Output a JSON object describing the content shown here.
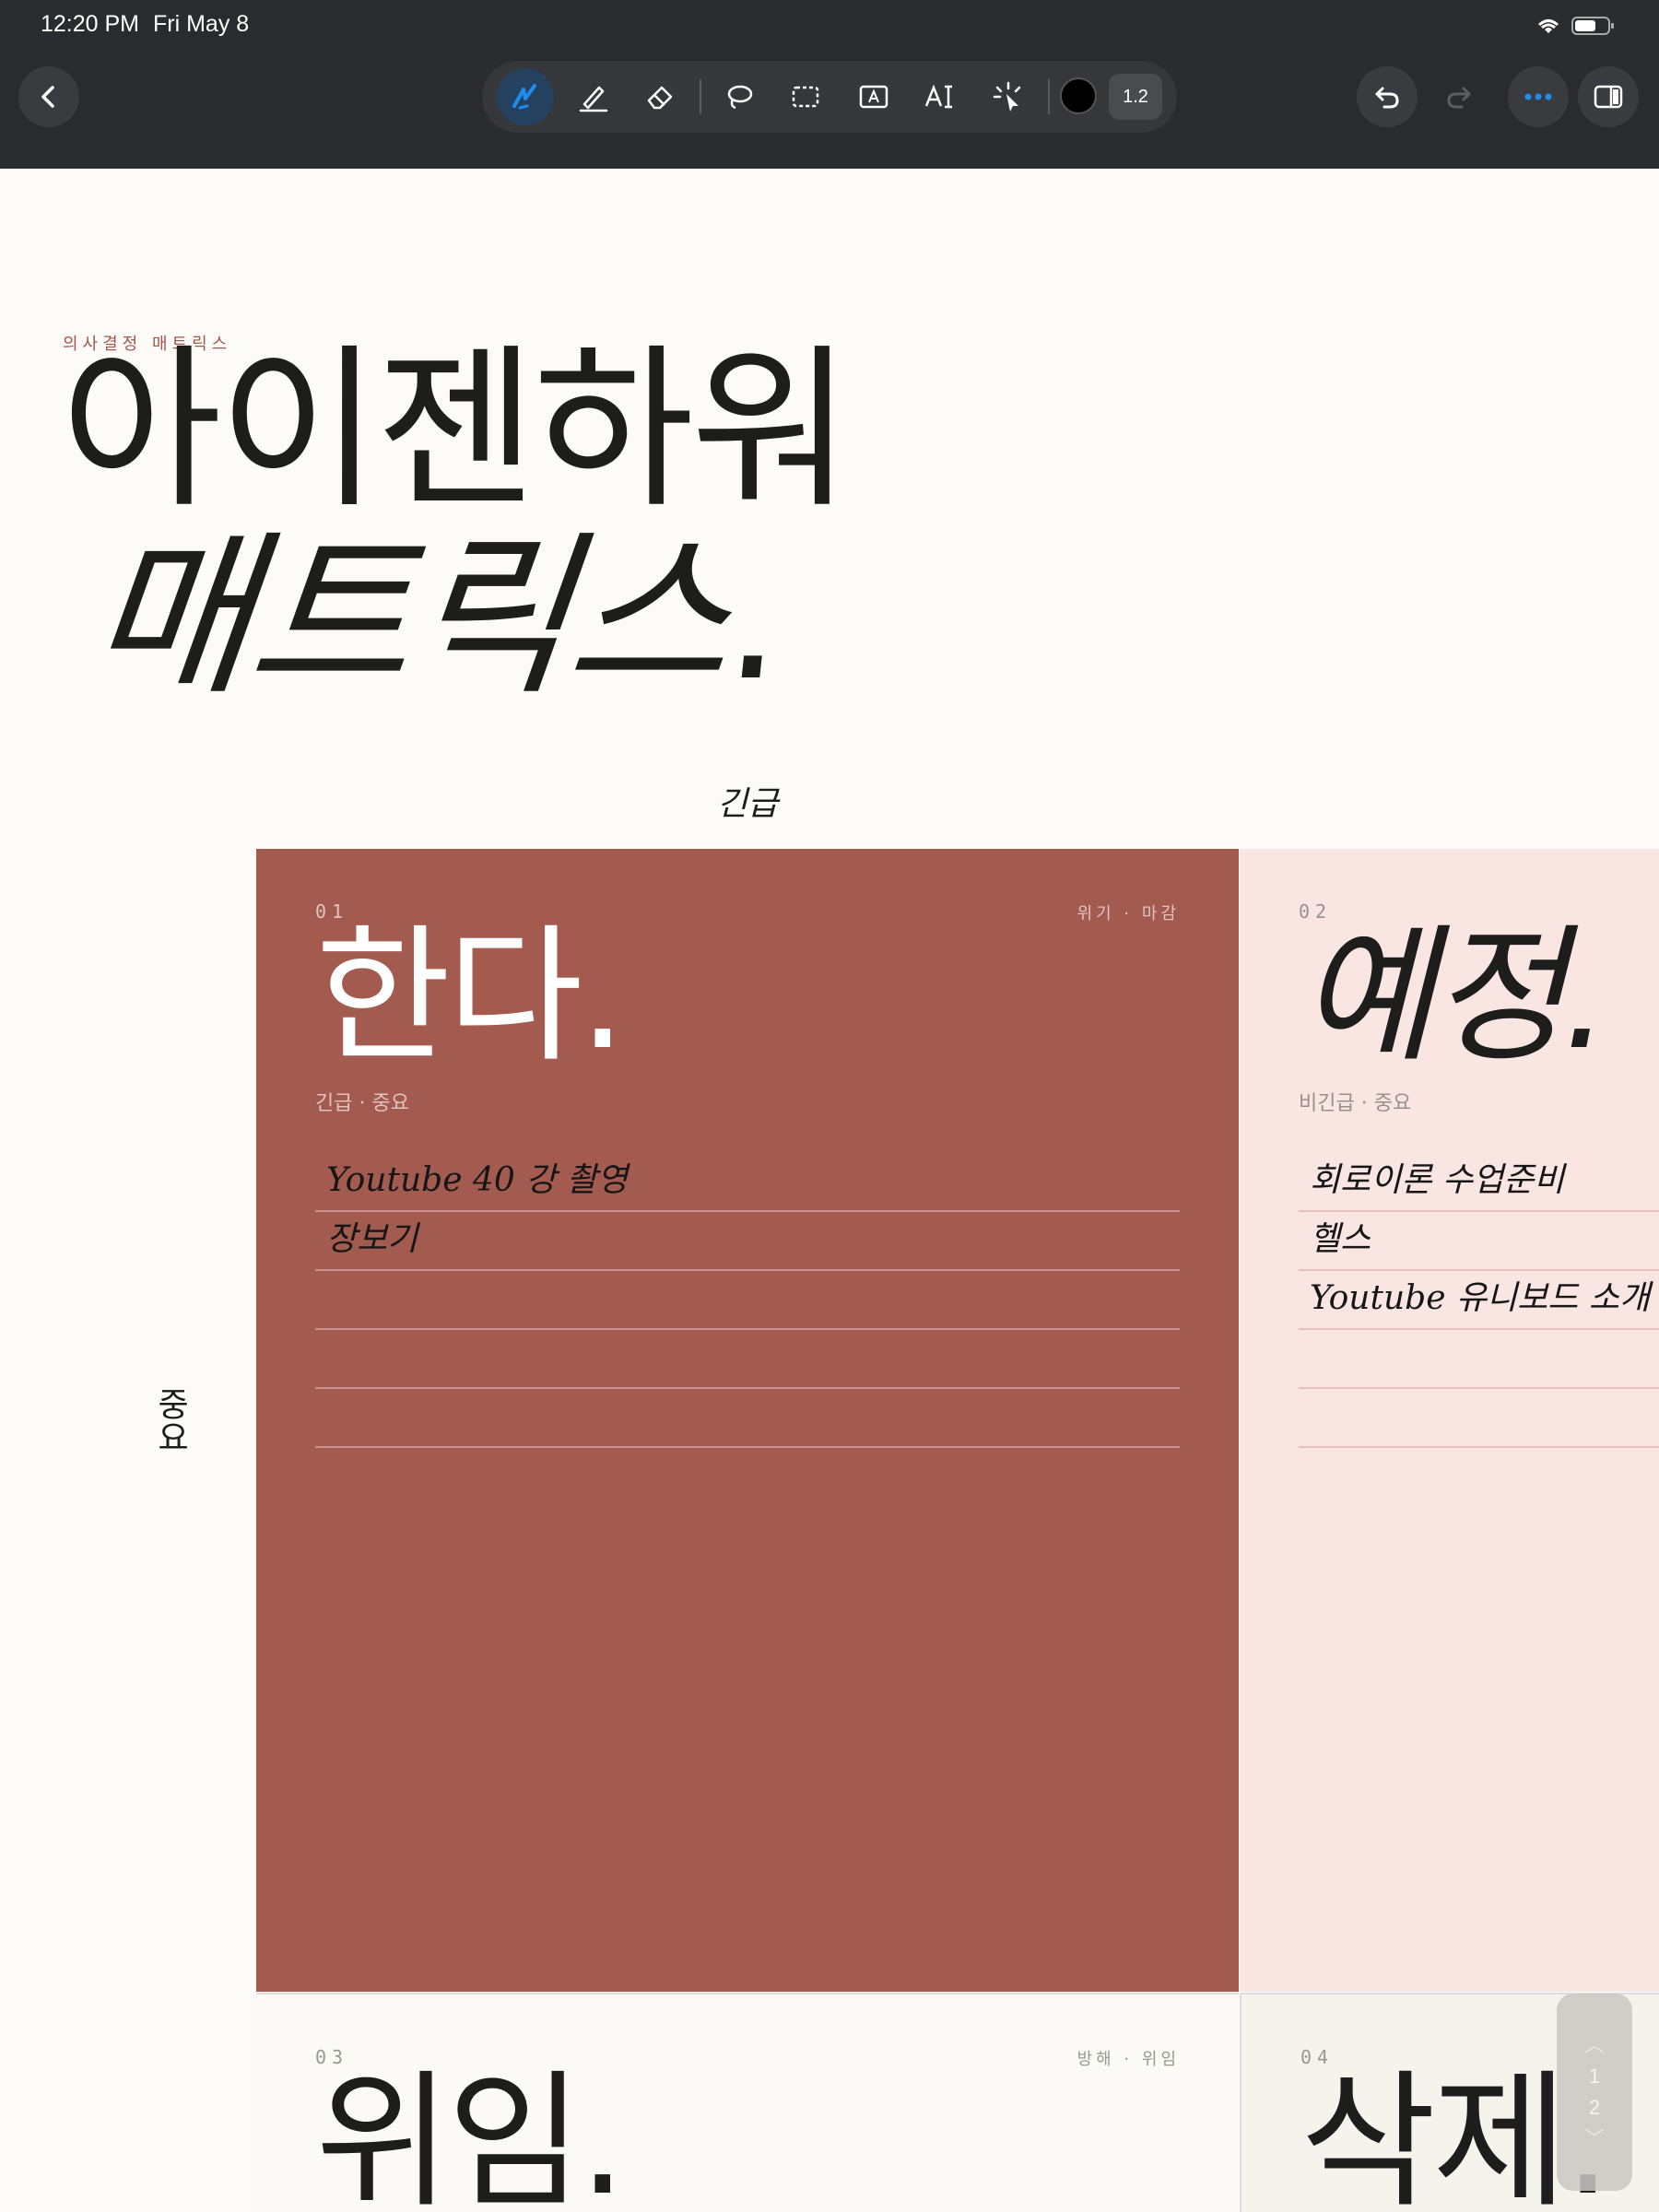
{
  "status_bar": {
    "time": "12:20 PM",
    "date": "Fri May 8"
  },
  "toolbar": {
    "tools": [
      "pen",
      "highlighter",
      "eraser",
      "lasso",
      "shape",
      "text-box",
      "text",
      "laser-pointer"
    ],
    "active_tool": "pen",
    "pen_color": "#000000",
    "stroke_size": "1.2"
  },
  "page": {
    "kicker": "의사결정 매트릭스",
    "title_line1": "아이젠하워",
    "title_line2": "매트릭스",
    "title_dot": ".",
    "axis_top": "긴급",
    "axis_left": "중요"
  },
  "quadrants": {
    "q1": {
      "num": "01",
      "tag": "위기 · 마감",
      "title": "한다.",
      "subtitle": "긴급 · 중요",
      "tasks": [
        "Youtube 40 강 촬영",
        "장보기",
        "",
        "",
        ""
      ]
    },
    "q2": {
      "num": "02",
      "tag": "",
      "title": "예정.",
      "subtitle": "비긴급 · 중요",
      "tasks": [
        "회로이론 수업준비",
        "헬스",
        "Youtube 유니보드 소개",
        "",
        ""
      ]
    },
    "q3": {
      "num": "03",
      "tag": "방해 · 위임",
      "title": "위임."
    },
    "q4": {
      "num": "04",
      "title": "삭제."
    }
  },
  "pager": {
    "pages": [
      "1",
      "2"
    ]
  },
  "colors": {
    "q1_bg": "#a35a4f",
    "q2_bg": "#f9e5e1",
    "accent": "#a5554c",
    "toolbar_bg": "#2a2b2e"
  }
}
